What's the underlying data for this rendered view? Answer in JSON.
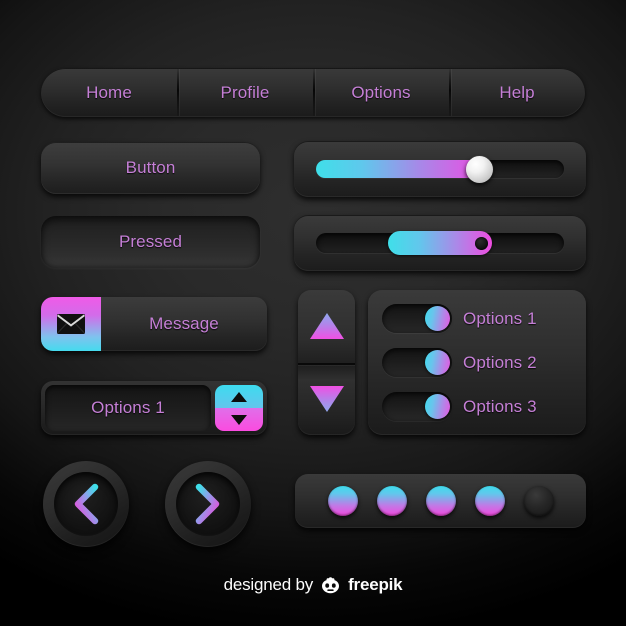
{
  "theme": {
    "background_dark": "#000000",
    "background_center": "#2e2e2e",
    "label_purple": "#c57fd6",
    "accent_cyan": "#3fdfe9",
    "accent_magenta": "#e94fe3",
    "panel_top": "#3b3b3b",
    "panel_bottom": "#1c1c1c"
  },
  "navbar": {
    "items": [
      {
        "label": "Home",
        "icon": "nav-home-icon"
      },
      {
        "label": "Profile",
        "icon": "nav-profile-icon"
      },
      {
        "label": "Options",
        "icon": "nav-options-icon"
      },
      {
        "label": "Help",
        "icon": "nav-help-icon"
      }
    ]
  },
  "buttons": {
    "normal_label": "Button",
    "pressed_label": "Pressed"
  },
  "sliders": [
    {
      "name": "slider-filled",
      "value": 66,
      "min": 0,
      "max": 100,
      "style": "knob"
    },
    {
      "name": "slider-pill",
      "value": 50,
      "min": 0,
      "max": 100,
      "style": "pill"
    }
  ],
  "message_button": {
    "label": "Message",
    "icon": "envelope-icon",
    "icon_gradient_from": "#f05ae8",
    "icon_gradient_to": "#45dbee"
  },
  "spinner": {
    "value": "Options 1",
    "up_icon": "triangle-up-icon",
    "down_icon": "triangle-down-icon"
  },
  "arrow_pad": {
    "up_icon": "triangle-up-icon",
    "down_icon": "triangle-down-icon"
  },
  "toggles": [
    {
      "label": "Options 1",
      "checked": true
    },
    {
      "label": "Options 2",
      "checked": true
    },
    {
      "label": "Options 3",
      "checked": true
    }
  ],
  "nav_circles": [
    {
      "name": "previous",
      "icon": "chevron-left-icon"
    },
    {
      "name": "next",
      "icon": "chevron-right-icon"
    }
  ],
  "pagination": {
    "total": 5,
    "active": 4,
    "dots": [
      {
        "state": "on"
      },
      {
        "state": "on"
      },
      {
        "state": "on"
      },
      {
        "state": "on"
      },
      {
        "state": "off"
      }
    ]
  },
  "footer": {
    "prefix": "designed by",
    "brand": "freepik",
    "logo_icon": "freepik-logo-icon"
  }
}
